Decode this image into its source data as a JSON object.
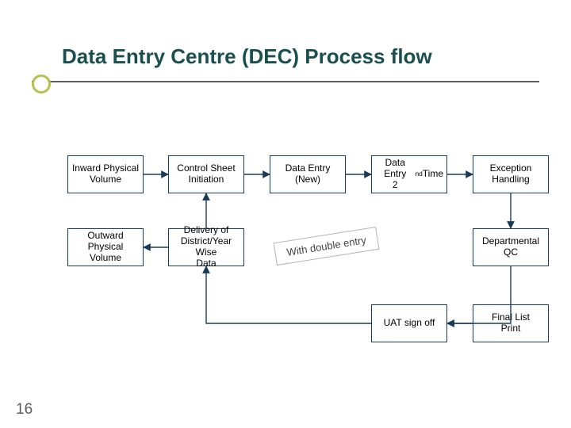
{
  "title": "Data Entry Centre (DEC) Process flow",
  "page_number": "16",
  "annotation": "With double entry",
  "boxes": {
    "inward": "Inward Physical\nVolume",
    "control": "Control Sheet\nInitiation",
    "entry1": "Data Entry (New)",
    "entry2": "Data Entry\n2nd Time",
    "exception": "Exception\nHandling",
    "outward": "Outward Physical\nVolume",
    "delivery": "Delivery of\nDistrict/Year Wise\nData",
    "deptqc": "Departmental QC",
    "uat": "UAT sign off",
    "finalprint": "Final List\nPrint"
  }
}
